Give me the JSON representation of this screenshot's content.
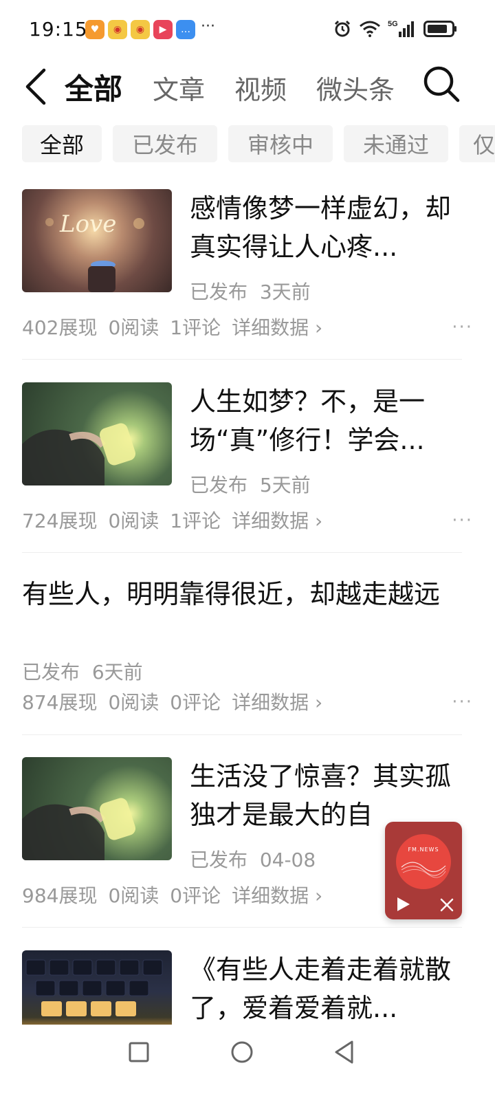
{
  "status": {
    "time": "19:15",
    "more": "···",
    "network": "5G"
  },
  "header": {
    "tabs": [
      {
        "label": "全部",
        "active": true
      },
      {
        "label": "文章",
        "active": false
      },
      {
        "label": "视频",
        "active": false
      },
      {
        "label": "微头条",
        "active": false
      }
    ]
  },
  "filters": [
    {
      "label": "全部",
      "active": true
    },
    {
      "label": "已发布",
      "active": false
    },
    {
      "label": "审核中",
      "active": false
    },
    {
      "label": "未通过",
      "active": false
    },
    {
      "label": "仅",
      "active": false
    }
  ],
  "items": [
    {
      "title": "感情像梦一样虚幻，却真实得让人心疼...",
      "status": "已发布",
      "time": "3天前",
      "views": "402展现",
      "reads": "0阅读",
      "comments": "1评论",
      "detail": "详细数据",
      "thumb": "love-lighter-image"
    },
    {
      "title": "人生如梦？不，是一场“真”修行！学会...",
      "status": "已发布",
      "time": "5天前",
      "views": "724展现",
      "reads": "0阅读",
      "comments": "1评论",
      "detail": "详细数据",
      "thumb": "girl-jar-image"
    },
    {
      "title": "有些人，明明靠得很近，却越走越远",
      "status": "已发布",
      "time": "6天前",
      "views": "874展现",
      "reads": "0阅读",
      "comments": "0评论",
      "detail": "详细数据"
    },
    {
      "title": "生活没了惊喜？其实孤独才是最大的自",
      "status": "已发布",
      "time": "04-08",
      "views": "984展现",
      "reads": "0阅读",
      "comments": "0评论",
      "detail": "详细数据",
      "thumb": "girl-jar-image"
    },
    {
      "title": "《有些人走着走着就散了，爱着爱着就...",
      "thumb": "keyboard-love-image"
    }
  ],
  "fm": {
    "label": "FM.NEWS"
  },
  "more": "···",
  "colors": {
    "fm_bg": "#a93a38",
    "fm_disc": "#e7473f"
  }
}
